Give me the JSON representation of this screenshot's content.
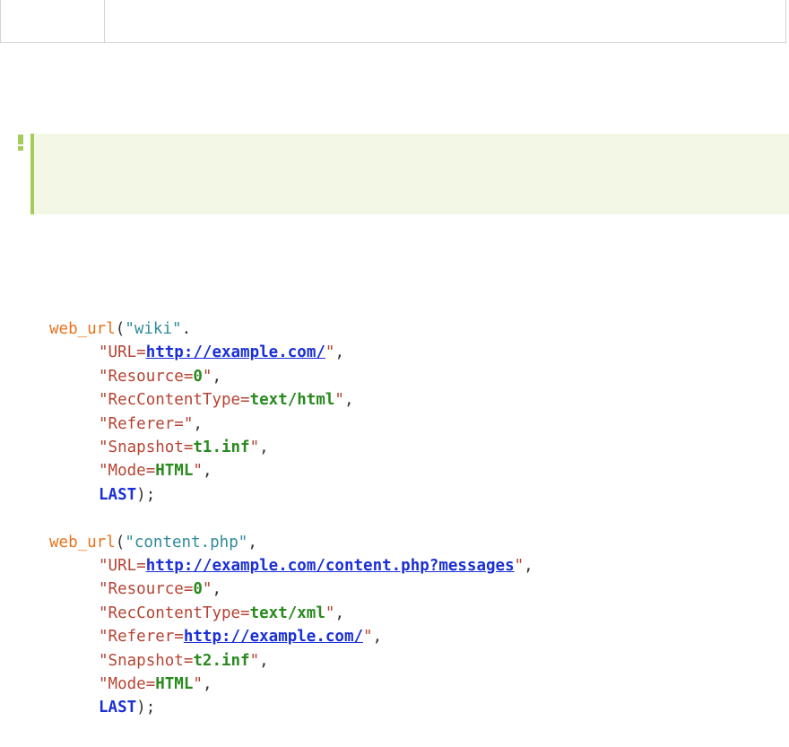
{
  "code_block": {
    "calls": [
      {
        "fn": "web_url",
        "name": "wiki",
        "name_terminator": ".",
        "params": [
          {
            "key": "URL=",
            "value": "http://example.com/",
            "kind": "url"
          },
          {
            "key": "Resource=",
            "value": "0",
            "kind": "val"
          },
          {
            "key": "RecContentType=",
            "value": "text/html",
            "kind": "val"
          },
          {
            "key": "Referer=",
            "value": "",
            "kind": "val"
          },
          {
            "key": "Snapshot=",
            "value": "t1.inf",
            "kind": "val"
          },
          {
            "key": "Mode=",
            "value": "HTML",
            "kind": "val"
          }
        ],
        "last": "LAST",
        "close": ");"
      },
      {
        "fn": "web_url",
        "name": "content.php",
        "name_terminator": ",",
        "params": [
          {
            "key": "URL=",
            "value": "http://example.com/content.php?messages",
            "kind": "url"
          },
          {
            "key": "Resource=",
            "value": "0",
            "kind": "val"
          },
          {
            "key": "RecContentType=",
            "value": "text/xml",
            "kind": "val"
          },
          {
            "key": "Referer=",
            "value": "http://example.com/",
            "kind": "url"
          },
          {
            "key": "Snapshot=",
            "value": "t2.inf",
            "kind": "val"
          },
          {
            "key": "Mode=",
            "value": "HTML",
            "kind": "val"
          }
        ],
        "last": "LAST",
        "close": ");"
      }
    ]
  },
  "colors": {
    "function": "#e8721c",
    "string_name": "#2e8b9a",
    "param_key": "#b54434",
    "param_value": "#2a8a1f",
    "url": "#1a2fd6",
    "keyword_last": "#1a2fd6",
    "note_background": "#f2f7e6",
    "note_border": "#a4cc5a"
  },
  "note_panel": {
    "icon": "exclamation-icon"
  }
}
